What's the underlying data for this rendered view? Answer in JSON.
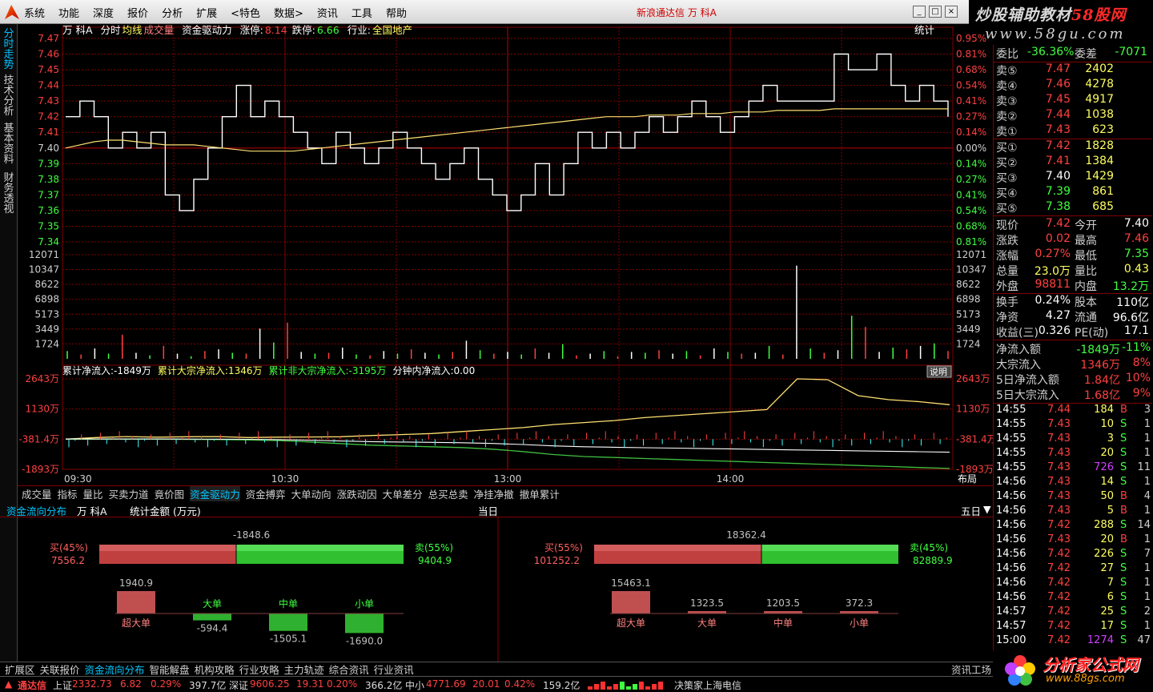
{
  "menubar": {
    "items": [
      "系统",
      "功能",
      "深度",
      "报价",
      "分析",
      "扩展",
      "<特色",
      "数据>",
      "资讯",
      "工具",
      "帮助"
    ],
    "window_title": "新浪通达信  万  科A",
    "buttons": [
      "_",
      "□",
      "×"
    ]
  },
  "watermark": {
    "line1a": "炒股辅助教材",
    "line1b": "58股网",
    "line2": "www.58gu.com"
  },
  "lefttabs": [
    "分时走势",
    "技术分析",
    "基本资料",
    "财务透视"
  ],
  "chart": {
    "header": {
      "stock": "万  科A",
      "mode": "分时",
      "avg_label": "均线",
      "vol_label": "成交量",
      "driver": "资金驱动力",
      "limit_up_label": "涨停:",
      "limit_up": "8.14",
      "limit_down_label": "跌停:",
      "limit_down": "6.66",
      "industry_label": "行业:",
      "industry": "全国地产",
      "stat_label": "统计"
    },
    "price_labels": [
      "7.47",
      "7.46",
      "7.45",
      "7.44",
      "7.43",
      "7.42",
      "7.41",
      "7.40",
      "7.39",
      "7.38",
      "7.37",
      "7.36",
      "7.35",
      "7.34"
    ],
    "pct_labels": [
      "0.95%",
      "0.81%",
      "0.68%",
      "0.54%",
      "0.41%",
      "0.27%",
      "0.14%",
      "0.00%",
      "0.14%",
      "0.27%",
      "0.41%",
      "0.54%",
      "0.68%",
      "0.81%"
    ],
    "vol_labels": [
      "12071",
      "10347",
      "8622",
      "6898",
      "5173",
      "3449",
      "1724"
    ],
    "flow_header": {
      "total": "累计净流入:-1849万",
      "big": "累计大宗净流入:1346万",
      "nonbig": "累计非大宗净流入:-3195万",
      "minute": "分钟内净流入:0.00",
      "explain": "说明"
    },
    "flow_labels": [
      "2643万",
      "1130万",
      "-381.4万",
      "-1893万"
    ],
    "time_labels": [
      "09:30",
      "10:30",
      "13:00",
      "14:00"
    ],
    "layout_button": "布局",
    "price_series": [
      7.42,
      7.43,
      7.42,
      7.4,
      7.41,
      7.4,
      7.41,
      7.37,
      7.36,
      7.38,
      7.4,
      7.42,
      7.44,
      7.42,
      7.43,
      7.42,
      7.41,
      7.4,
      7.39,
      7.41,
      7.4,
      7.39,
      7.4,
      7.41,
      7.4,
      7.39,
      7.38,
      7.39,
      7.4,
      7.38,
      7.37,
      7.36,
      7.37,
      7.39,
      7.37,
      7.39,
      7.41,
      7.4,
      7.41,
      7.4,
      7.41,
      7.42,
      7.41,
      7.42,
      7.43,
      7.42,
      7.41,
      7.42,
      7.43,
      7.44,
      7.43,
      7.43,
      7.43,
      7.43,
      7.46,
      7.45,
      7.45,
      7.46,
      7.44,
      7.43,
      7.44,
      7.43,
      7.42
    ],
    "avg_series": [
      7.4,
      7.402,
      7.404,
      7.405,
      7.405,
      7.404,
      7.403,
      7.402,
      7.402,
      7.402,
      7.401,
      7.4,
      7.399,
      7.398,
      7.398,
      7.398,
      7.398,
      7.399,
      7.4,
      7.401,
      7.402,
      7.403,
      7.404,
      7.405,
      7.406,
      7.407,
      7.408,
      7.409,
      7.41,
      7.411,
      7.412,
      7.413,
      7.414,
      7.415,
      7.416,
      7.417,
      7.418,
      7.419,
      7.42,
      7.42,
      7.42,
      7.421,
      7.421,
      7.421,
      7.422,
      7.422,
      7.422,
      7.423,
      7.423,
      7.423,
      7.424,
      7.424,
      7.424,
      7.424,
      7.425,
      7.425,
      7.425,
      7.425,
      7.425,
      7.425,
      7.425,
      7.425,
      7.425
    ],
    "volume_series": [
      900,
      500,
      1200,
      600,
      2800,
      700,
      400,
      1500,
      600,
      300,
      900,
      1100,
      700,
      600,
      3500,
      1900,
      4200,
      800,
      600,
      700,
      1300,
      500,
      400,
      900,
      600,
      1100,
      700,
      500,
      800,
      2100,
      1000,
      600,
      800,
      500,
      1200,
      700,
      1700,
      400,
      600,
      900,
      300,
      800,
      700,
      1000,
      600,
      900,
      400,
      1200,
      800,
      600,
      700,
      1500,
      500,
      10800,
      1200,
      700,
      1000,
      5000,
      3700,
      800,
      1300,
      1100,
      1500,
      1800,
      900
    ],
    "flow_lines": {
      "total": [
        -381.4,
        -381,
        -380,
        -385,
        -390,
        -400,
        -420,
        -450,
        -520,
        -600,
        -680,
        -720,
        -760,
        -800,
        -880,
        -1000,
        -1150,
        -1250,
        -1300,
        -1350,
        -1400,
        -1450,
        -1500,
        -1550,
        -1600,
        -1650,
        -1700,
        -1750,
        -1800,
        -1849
      ],
      "big": [
        -381.4,
        -300,
        -250,
        -280,
        -260,
        -250,
        -300,
        -280,
        -270,
        -260,
        -200,
        -150,
        -100,
        0,
        100,
        200,
        350,
        450,
        550,
        700,
        800,
        900,
        1000,
        1100,
        2643,
        2600,
        1800,
        1600,
        1500,
        1346
      ]
    }
  },
  "toolbar": {
    "items": [
      "成交量",
      "指标",
      "量比",
      "买卖力道",
      "竟价图",
      "资金驱动力",
      "资金搏弈",
      "大单动向",
      "涨跌动因",
      "大单差分",
      "总买总卖",
      "净挂净撤",
      "撤单累计"
    ],
    "active": "资金驱动力"
  },
  "flowdist": {
    "title": "资金流向分布",
    "stock": "万  科A",
    "unit": "统计金额 (万元)",
    "today": "当日",
    "fiveday": "五日",
    "left": {
      "net": "-1848.6",
      "buy_label": "买(45%)",
      "buy": "7556.2",
      "sell_label": "卖(55%)",
      "sell": "9404.9",
      "buy_ratio": 0.45,
      "cats": [
        {
          "name": "超大单",
          "value": "1940.9",
          "amount": 1940.9
        },
        {
          "name": "大单",
          "value": "-594.4",
          "amount": -594.4
        },
        {
          "name": "中单",
          "value": "-1505.1",
          "amount": -1505.1
        },
        {
          "name": "小单",
          "value": "-1690.0",
          "amount": -1690.0
        }
      ]
    },
    "right": {
      "net": "18362.4",
      "buy_label": "买(55%)",
      "buy": "101252.2",
      "sell_label": "卖(45%)",
      "sell": "82889.9",
      "buy_ratio": 0.55,
      "cats": [
        {
          "name": "超大单",
          "value": "15463.1",
          "amount": 15463.1
        },
        {
          "name": "大单",
          "value": "1323.5",
          "amount": 1323.5
        },
        {
          "name": "中单",
          "value": "1203.5",
          "amount": 1203.5
        },
        {
          "name": "小单",
          "value": "372.3",
          "amount": 372.3
        }
      ]
    }
  },
  "bottomtabs": {
    "items": [
      "扩展区",
      "关联报价",
      "资金流向分布",
      "智能解盘",
      "机构攻略",
      "行业攻略",
      "主力轨迹",
      "综合资讯",
      "行业资讯"
    ],
    "active": "资金流向分布",
    "right": "资讯工场"
  },
  "statusbar": {
    "app": "通达信",
    "sh_label": "上证",
    "sh": "2332.73",
    "sh_chg": "6.82",
    "sh_pct": "0.29%",
    "sh_amt": "397.7亿",
    "sz_label": "深证",
    "sz": "9606.25",
    "sz_chg": "19.31",
    "sz_pct": "0.20%",
    "sz_amt": "366.2亿",
    "zx_label": "中小",
    "zx": "4771.69",
    "zx_chg": "20.01",
    "zx_pct": "0.42%",
    "zx_amt": "159.2亿",
    "broker": "决策家上海电信"
  },
  "quote": {
    "weibi_label": "委比",
    "weibi": "-36.36%",
    "weicha_label": "委差",
    "weicha": "-7071",
    "sells": [
      {
        "label": "卖⑤",
        "price": "7.47",
        "vol": "2402"
      },
      {
        "label": "卖④",
        "price": "7.46",
        "vol": "4278"
      },
      {
        "label": "卖③",
        "price": "7.45",
        "vol": "4917"
      },
      {
        "label": "卖②",
        "price": "7.44",
        "vol": "1038"
      },
      {
        "label": "卖①",
        "price": "7.43",
        "vol": "623"
      }
    ],
    "buys": [
      {
        "label": "买①",
        "price": "7.42",
        "vol": "1828"
      },
      {
        "label": "买②",
        "price": "7.41",
        "vol": "1384"
      },
      {
        "label": "买③",
        "price": "7.40",
        "vol": "1429"
      },
      {
        "label": "买④",
        "price": "7.39",
        "vol": "861"
      },
      {
        "label": "买⑤",
        "price": "7.38",
        "vol": "685"
      }
    ],
    "stats": [
      {
        "l1": "现价",
        "v1": "7.42",
        "l2": "今开",
        "v2": "7.40",
        "c1": "#ff4040",
        "c2": "#ffffff"
      },
      {
        "l1": "涨跌",
        "v1": "0.02",
        "l2": "最高",
        "v2": "7.46",
        "c1": "#ff4040",
        "c2": "#ff4040"
      },
      {
        "l1": "涨幅",
        "v1": "0.27%",
        "l2": "最低",
        "v2": "7.35",
        "c1": "#ff4040",
        "c2": "#40ff40"
      },
      {
        "l1": "总量",
        "v1": "23.0万",
        "l2": "量比",
        "v2": "0.43",
        "c1": "#ffff60",
        "c2": "#ffff60"
      },
      {
        "l1": "外盘",
        "v1": "98811",
        "l2": "内盘",
        "v2": "13.2万",
        "c1": "#ff4040",
        "c2": "#40ff40"
      }
    ],
    "stats2": [
      {
        "l1": "换手",
        "v1": "0.24%",
        "l2": "股本",
        "v2": "110亿"
      },
      {
        "l1": "净资",
        "v1": "4.27",
        "l2": "流通",
        "v2": "96.6亿"
      },
      {
        "l1": "收益(三)",
        "v1": "0.326",
        "l2": "PE(动)",
        "v2": "17.1"
      }
    ],
    "flows": [
      {
        "label": "净流入额",
        "value": "-1849万",
        "pct": "-11%",
        "color": "#40ff40"
      },
      {
        "label": "大宗流入",
        "value": "1346万",
        "pct": "8%",
        "color": "#ff4040"
      },
      {
        "label": "5日净流入额",
        "value": "1.84亿",
        "pct": "10%",
        "color": "#ff4040"
      },
      {
        "label": "5日大宗流入",
        "value": "1.68亿",
        "pct": "9%",
        "color": "#ff4040"
      }
    ],
    "ticks": [
      {
        "t": "14:55",
        "p": "7.44",
        "v": "184",
        "d": "B",
        "n": "3"
      },
      {
        "t": "14:55",
        "p": "7.43",
        "v": "10",
        "d": "S",
        "n": "1"
      },
      {
        "t": "14:55",
        "p": "7.43",
        "v": "3",
        "d": "S",
        "n": "1"
      },
      {
        "t": "14:55",
        "p": "7.43",
        "v": "20",
        "d": "S",
        "n": "1"
      },
      {
        "t": "14:55",
        "p": "7.43",
        "v": "726",
        "d": "S",
        "n": "11"
      },
      {
        "t": "14:56",
        "p": "7.43",
        "v": "14",
        "d": "S",
        "n": "1"
      },
      {
        "t": "14:56",
        "p": "7.43",
        "v": "50",
        "d": "B",
        "n": "4"
      },
      {
        "t": "14:56",
        "p": "7.43",
        "v": "5",
        "d": "B",
        "n": "1"
      },
      {
        "t": "14:56",
        "p": "7.42",
        "v": "288",
        "d": "S",
        "n": "14"
      },
      {
        "t": "14:56",
        "p": "7.43",
        "v": "20",
        "d": "B",
        "n": "1"
      },
      {
        "t": "14:56",
        "p": "7.42",
        "v": "226",
        "d": "S",
        "n": "7"
      },
      {
        "t": "14:56",
        "p": "7.42",
        "v": "27",
        "d": "S",
        "n": "1"
      },
      {
        "t": "14:56",
        "p": "7.42",
        "v": "7",
        "d": "S",
        "n": "1"
      },
      {
        "t": "14:56",
        "p": "7.42",
        "v": "6",
        "d": "S",
        "n": "1"
      },
      {
        "t": "14:57",
        "p": "7.42",
        "v": "25",
        "d": "S",
        "n": "2"
      },
      {
        "t": "14:57",
        "p": "7.42",
        "v": "17",
        "d": "S",
        "n": "1"
      },
      {
        "t": "15:00",
        "p": "7.42",
        "v": "1274",
        "d": "S",
        "n": "47"
      }
    ]
  },
  "brand": {
    "name": "分析家公式网",
    "url": "www.88gs.com"
  },
  "colors": {
    "up": "#ff4040",
    "down": "#40ff40",
    "grid": "#800000",
    "accent": "#00c8ff"
  }
}
